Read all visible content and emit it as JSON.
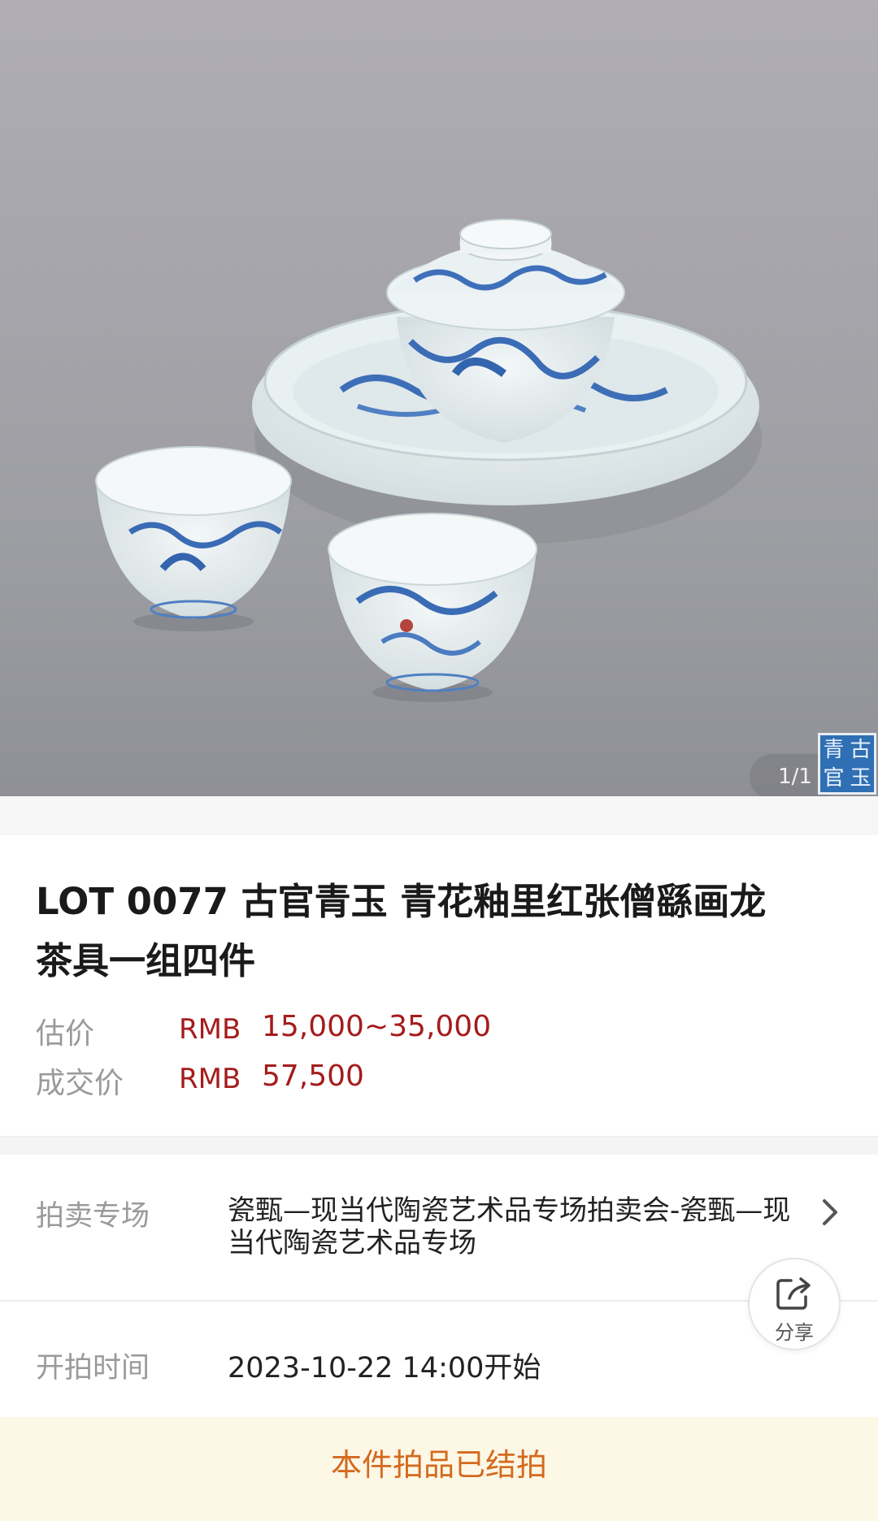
{
  "hero": {
    "counter": "1/1",
    "seal_text": "青古官玉"
  },
  "lot": {
    "title": "LOT 0077 古官青玉 青花釉里红张僧繇画龙茶具一组四件",
    "estimate_label": "估价",
    "estimate_currency": "RMB",
    "estimate_value": "15,000~35,000",
    "sold_label": "成交价",
    "sold_currency": "RMB",
    "sold_value": "57,500"
  },
  "details": {
    "session_label": "拍卖专场",
    "session_value": "瓷甄—现当代陶瓷艺术品专场拍卖会-瓷甄—现当代陶瓷艺术品专场",
    "start_label": "开拍时间",
    "start_value": "2023-10-22 14:00开始"
  },
  "share": {
    "label": "分享",
    "icon": "share-icon"
  },
  "footer": {
    "status": "本件拍品已结拍"
  },
  "colors": {
    "price": "#a51c1c",
    "footer_text": "#d46a1e",
    "footer_bg": "#fdf7e6"
  }
}
